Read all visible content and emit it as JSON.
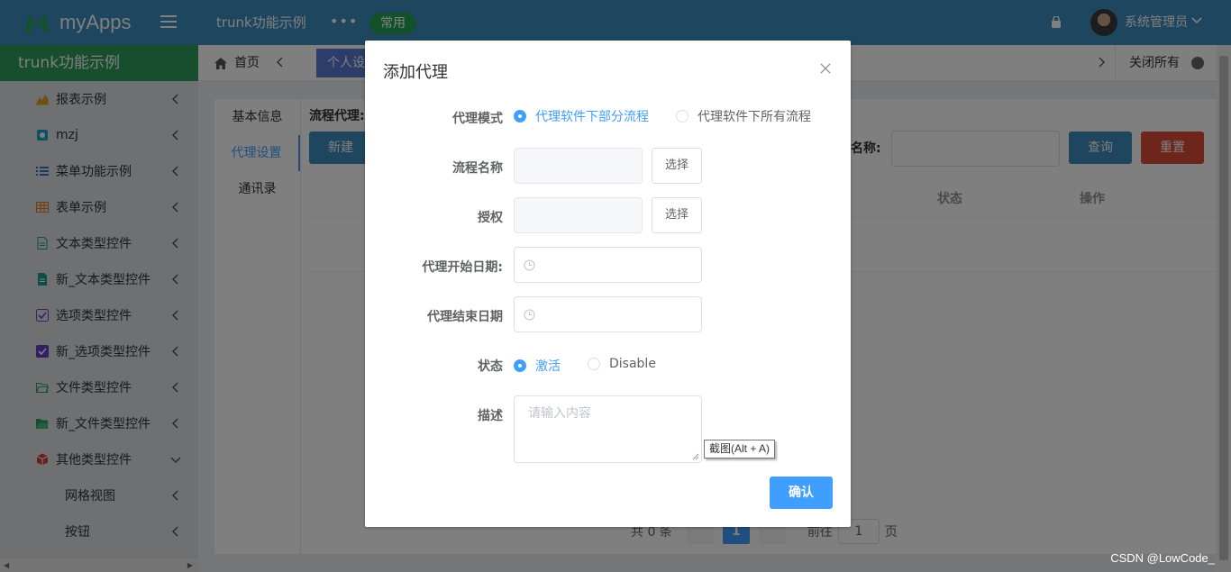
{
  "topbar": {
    "logo_text": "myApps",
    "app_name": "trunk功能示例",
    "more": "•••",
    "favorites": "常用",
    "user_name": "系统管理员"
  },
  "sidebar": {
    "title": "trunk功能示例",
    "items": [
      {
        "label": "报表示例",
        "icon": "chart-icon"
      },
      {
        "label": "mzj",
        "icon": "cube-icon"
      },
      {
        "label": "菜单功能示例",
        "icon": "list-icon"
      },
      {
        "label": "表单示例",
        "icon": "table-icon"
      },
      {
        "label": "文本类型控件",
        "icon": "document-icon"
      },
      {
        "label": "新_文本类型控件",
        "icon": "document-filled-icon"
      },
      {
        "label": "选项类型控件",
        "icon": "checkbox-icon"
      },
      {
        "label": "新_选项类型控件",
        "icon": "checkbox-filled-icon"
      },
      {
        "label": "文件类型控件",
        "icon": "folder-open-icon"
      },
      {
        "label": "新_文件类型控件",
        "icon": "folder-filled-icon"
      },
      {
        "label": "其他类型控件",
        "icon": "package-icon"
      }
    ],
    "sub_items": [
      "网格视图",
      "按钮"
    ]
  },
  "tabs": {
    "home": "首页",
    "active": "个人设",
    "close_all": "关闭所有"
  },
  "inner_nav": [
    "基本信息",
    "代理设置",
    "通讯录"
  ],
  "content": {
    "proc_label": "流程代理:",
    "new_button": "新建",
    "search_label": "程名称:",
    "query_button": "查询",
    "reset_button": "重置",
    "col_status": "状态",
    "col_op": "操作"
  },
  "pager": {
    "total": "共 0 条",
    "current": "1",
    "goto": "前往",
    "page_value": "1",
    "page_unit": "页"
  },
  "dialog": {
    "title": "添加代理",
    "mode_label": "代理模式",
    "mode_option_1": "代理软件下部分流程",
    "mode_option_2": "代理软件下所有流程",
    "flow_name_label": "流程名称",
    "select_1": "选择",
    "auth_label": "授权",
    "select_2": "选择",
    "start_label": "代理开始日期:",
    "end_label": "代理结束日期",
    "status_label": "状态",
    "status_option_1": "激活",
    "status_option_2": "Disable",
    "desc_label": "描述",
    "desc_placeholder": "请输入内容",
    "confirm": "确认"
  },
  "tooltip": "截图(Alt + A)",
  "watermark": "CSDN @LowCode_",
  "colors": {
    "topbar": "#3c8dbc",
    "sidebar_header": "#2c9d5c",
    "primary": "#409eff",
    "danger": "#dd4b39"
  }
}
